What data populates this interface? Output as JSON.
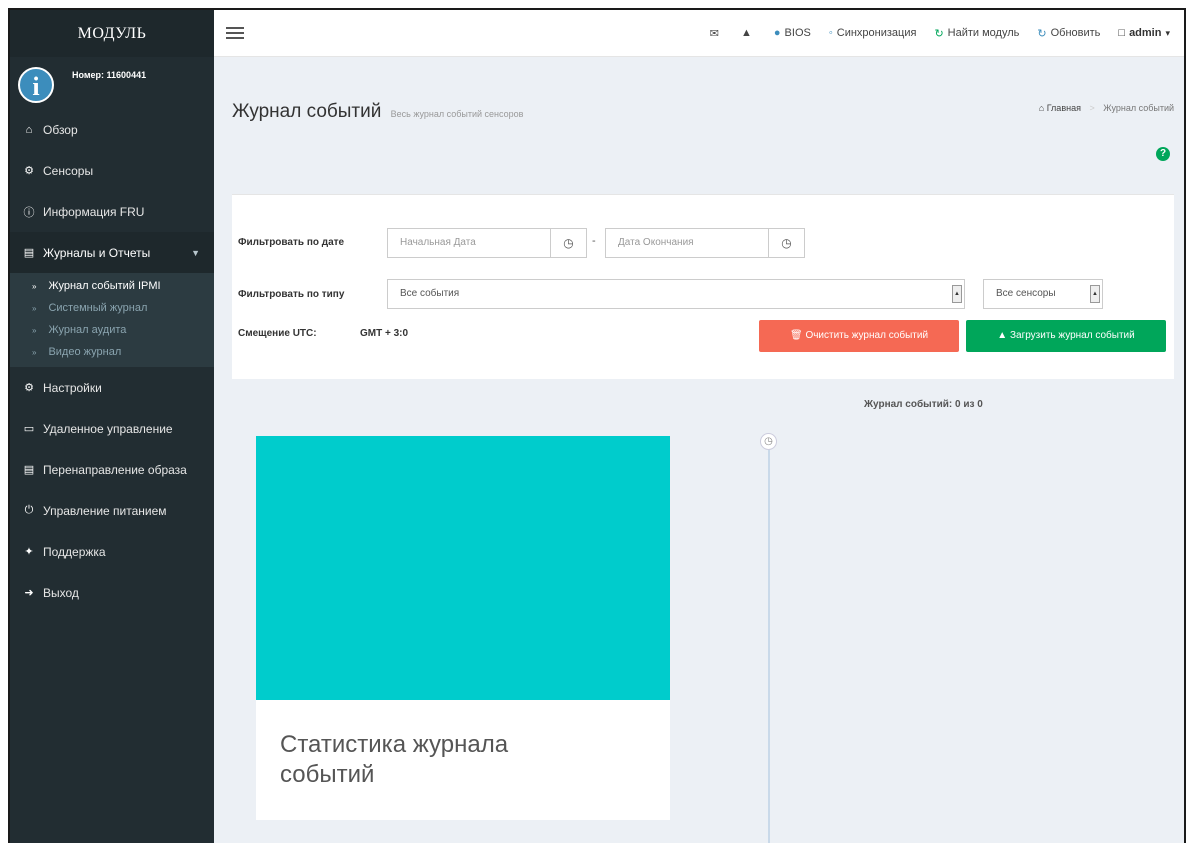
{
  "sidebar": {
    "brand": "МОДУЛЬ",
    "user_number": "Номер: 11600441",
    "items": [
      {
        "label": "Обзор",
        "icon": "home-icon"
      },
      {
        "label": "Сенсоры",
        "icon": "cogs-icon"
      },
      {
        "label": "Информация FRU",
        "icon": "info-circle-icon"
      },
      {
        "label": "Журналы и Отчеты",
        "icon": "chart-icon"
      },
      {
        "label": "Настройки",
        "icon": "gear-icon"
      },
      {
        "label": "Удаленное управление",
        "icon": "monitor-icon"
      },
      {
        "label": "Перенаправление образа",
        "icon": "disk-icon"
      },
      {
        "label": "Управление питанием",
        "icon": "power-icon"
      },
      {
        "label": "Поддержка",
        "icon": "wrench-icon"
      },
      {
        "label": "Выход",
        "icon": "signout-icon"
      }
    ],
    "submenu": [
      {
        "label": "Журнал событий IPMI"
      },
      {
        "label": "Системный журнал"
      },
      {
        "label": "Журнал аудита"
      },
      {
        "label": "Видео журнал"
      }
    ]
  },
  "topbar": {
    "bios": "BIOS",
    "sync": "Синхронизация",
    "find_module": "Найти модуль",
    "refresh": "Обновить",
    "user": "admin"
  },
  "page": {
    "title": "Журнал событий",
    "subtitle": "Весь журнал событий сенсоров",
    "breadcrumb_home": "Главная",
    "breadcrumb_current": "Журнал событий"
  },
  "filters": {
    "date_label": "Фильтровать по дате",
    "start_placeholder": "Начальная Дата",
    "end_placeholder": "Дата Окончания",
    "type_label": "Фильтровать по типу",
    "type_value": "Все события",
    "sensor_value": "Все сенсоры",
    "utc_label": "Смещение UTC:",
    "utc_value": "GMT + 3:0",
    "clear_button": "Очистить журнал событий",
    "download_button": "Загрузить журнал событий"
  },
  "log_counter": "Журнал событий: 0 из 0",
  "stat_card": {
    "title": "Статистика журнала событий",
    "color": "#00cccc"
  }
}
